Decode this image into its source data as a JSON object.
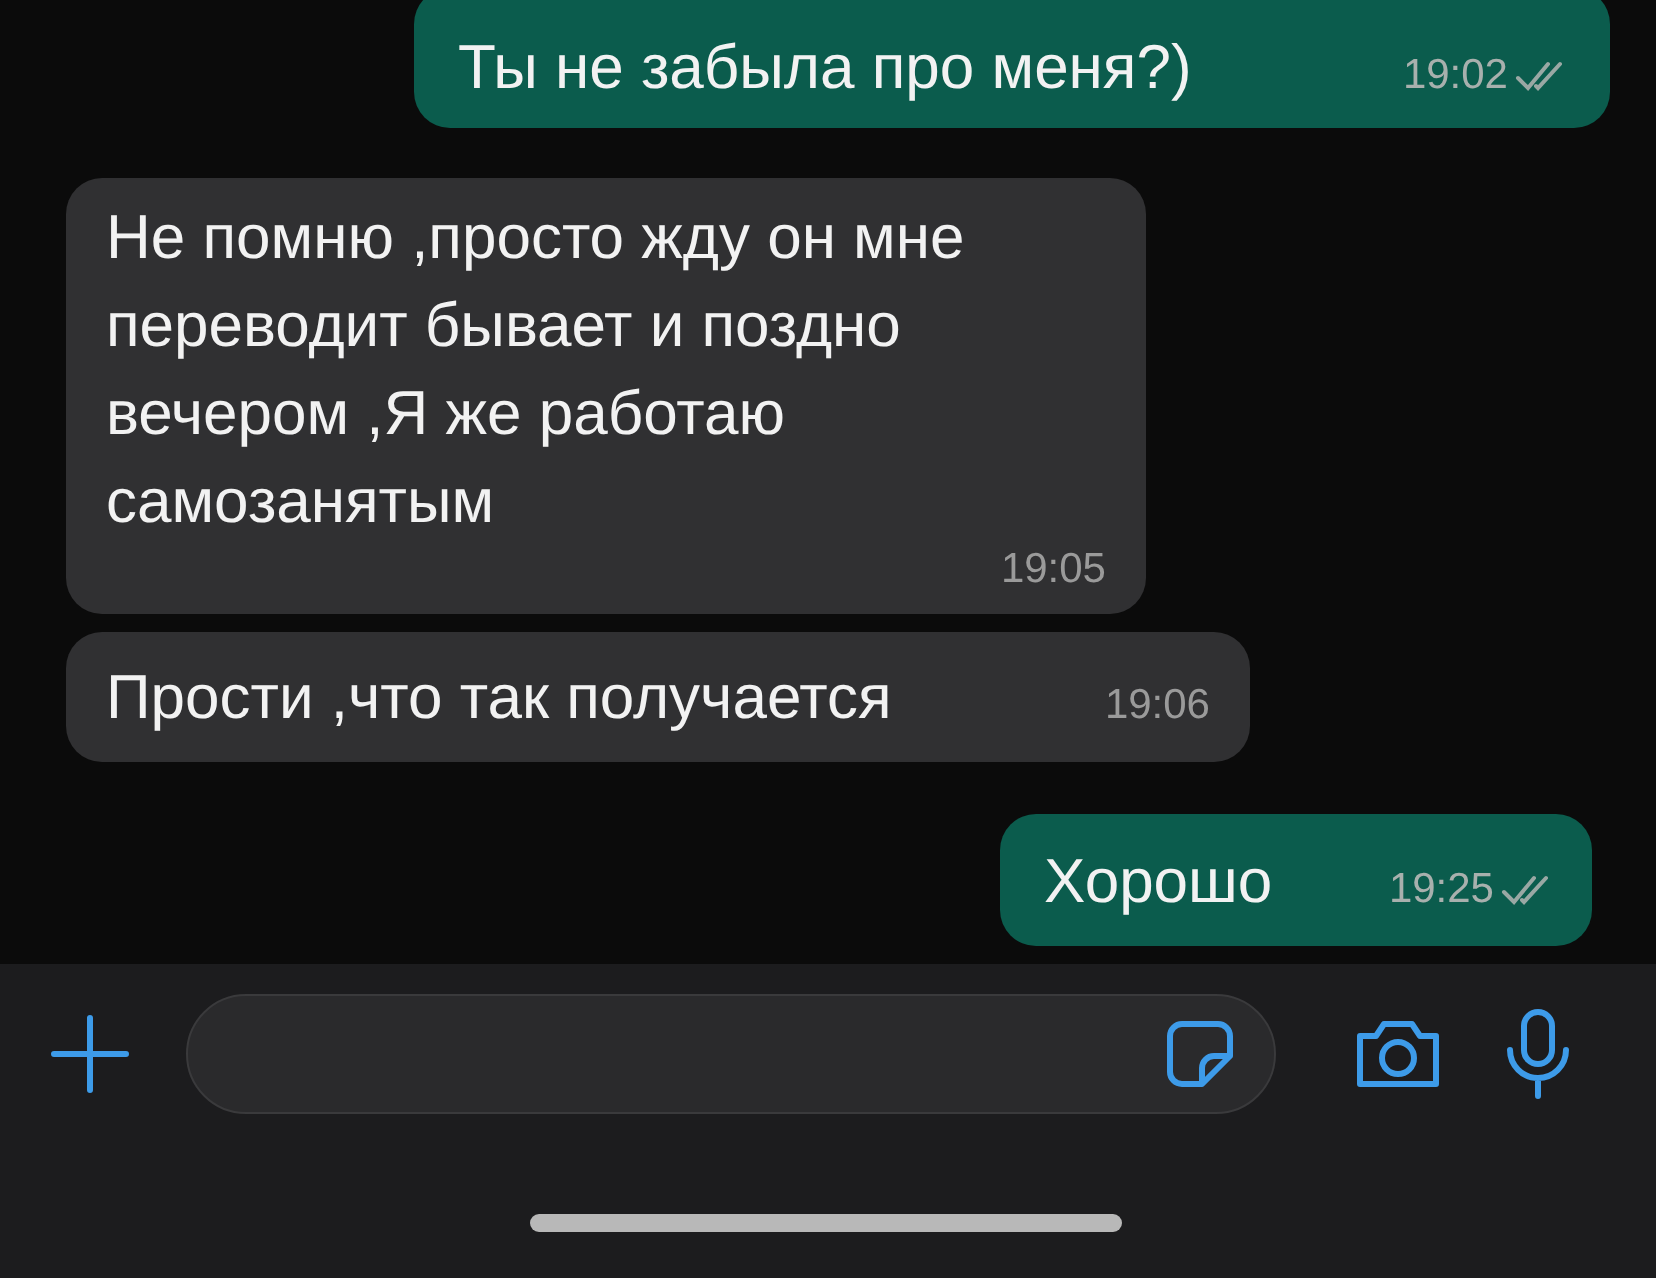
{
  "messages": [
    {
      "kind": "outgoing",
      "text": "Ты не забыла про меня?)",
      "time": "19:02",
      "read": false
    },
    {
      "kind": "incoming",
      "text": "Не помню ,просто жду он мне переводит бывает и поздно вечером ,Я же работаю самозанятым",
      "time": "19:05"
    },
    {
      "kind": "incoming",
      "text": "Прости ,что так получается",
      "time": "19:06"
    },
    {
      "kind": "outgoing",
      "text": "Хорошо",
      "time": "19:25",
      "read": false
    }
  ]
}
